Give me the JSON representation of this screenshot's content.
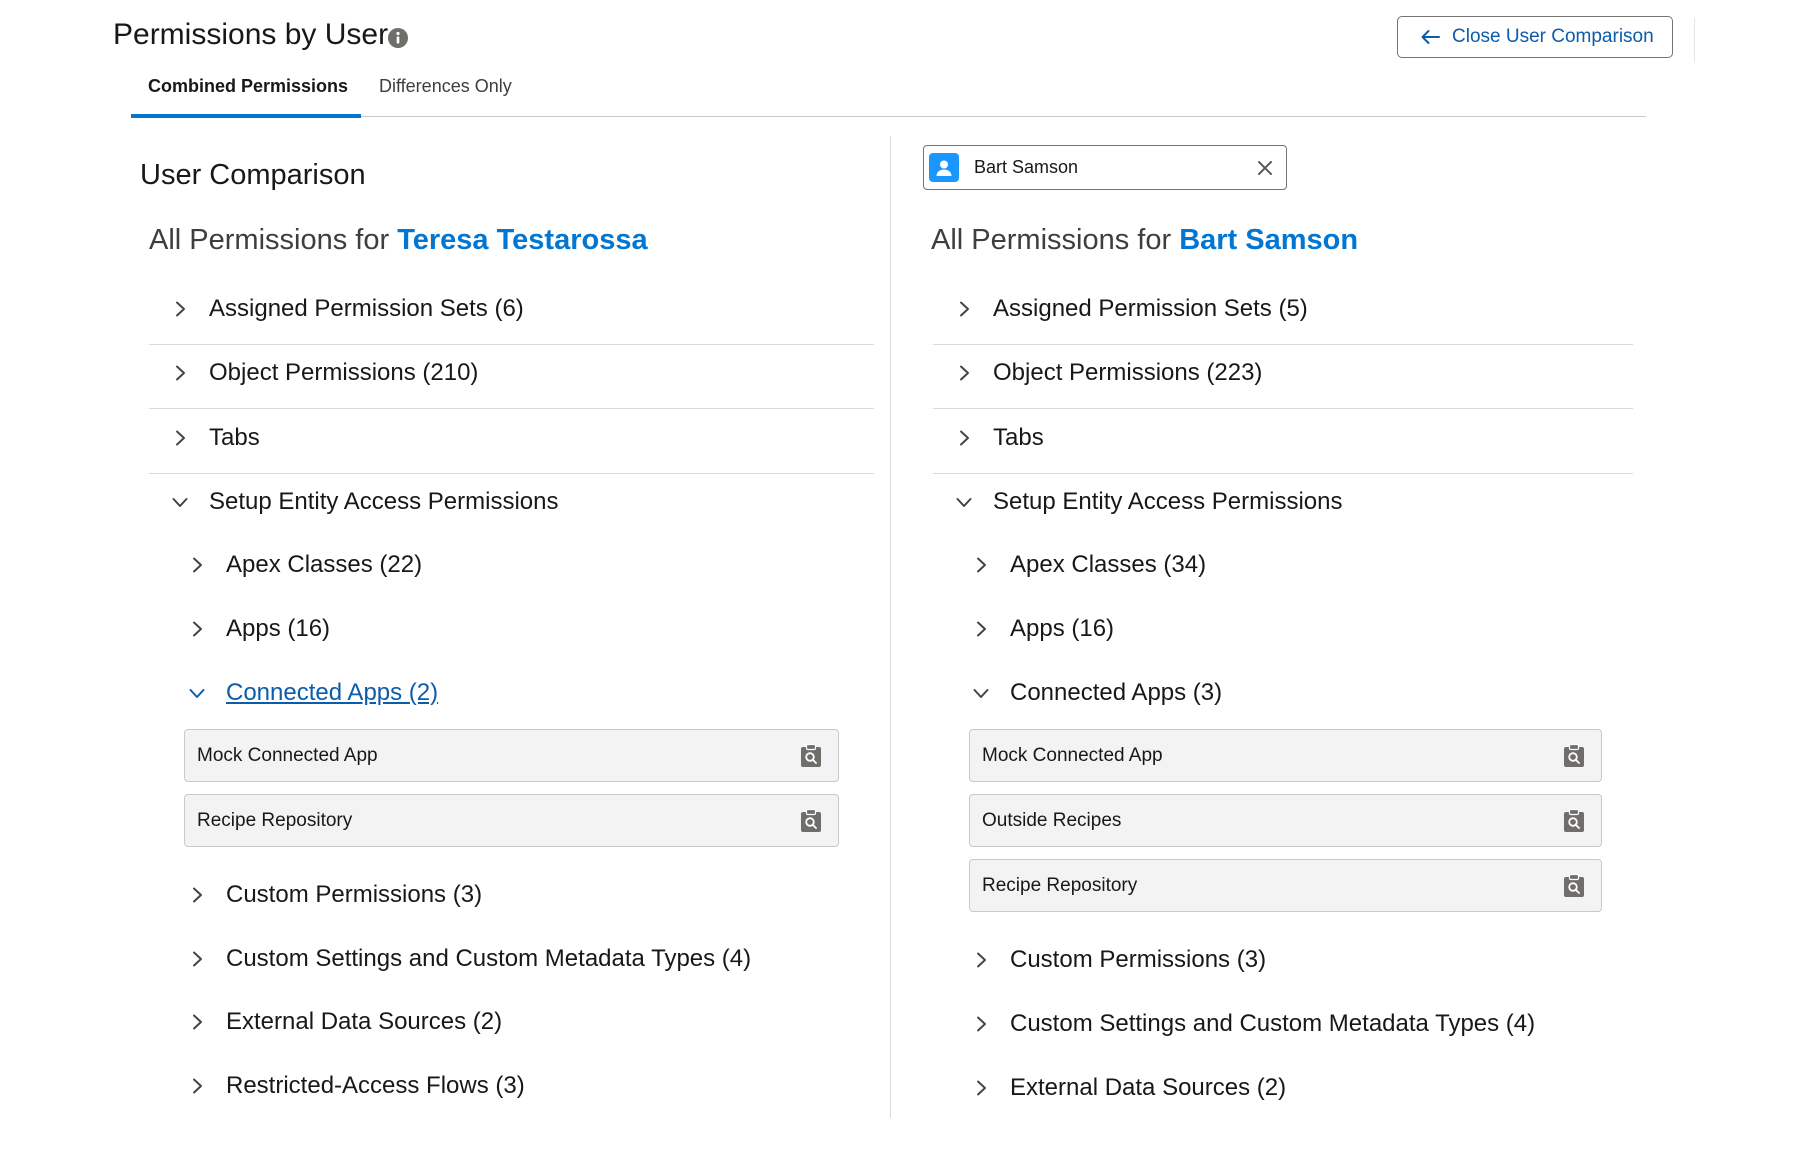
{
  "header": {
    "title": "Permissions by User",
    "info_icon": "info-icon",
    "close_button_label": "Close User Comparison",
    "close_button_icon": "arrow-left-icon"
  },
  "tabs": [
    {
      "label": "Combined Permissions",
      "active": true
    },
    {
      "label": "Differences Only",
      "active": false
    }
  ],
  "section_title": "User Comparison",
  "user_picker": {
    "selected_user": "Bart Samson",
    "avatar_icon": "user-icon",
    "clear_icon": "close-icon"
  },
  "accent_color": "#0176d3",
  "left_column": {
    "heading_prefix": "All Permissions for",
    "user_name": "Teresa Testarossa",
    "sections": [
      {
        "label": "Assigned Permission Sets (6)",
        "expanded": false
      },
      {
        "label": "Object Permissions (210)",
        "expanded": false
      },
      {
        "label": "Tabs",
        "expanded": false
      },
      {
        "label": "Setup Entity Access Permissions",
        "expanded": true,
        "children": [
          {
            "label": "Apex Classes (22)",
            "expanded": false
          },
          {
            "label": "Apps (16)",
            "expanded": false
          },
          {
            "label": "Connected Apps (2)",
            "expanded": true,
            "items": [
              "Mock Connected App",
              "Recipe Repository"
            ]
          },
          {
            "label": "Custom Permissions (3)",
            "expanded": false
          },
          {
            "label": "Custom Settings and Custom Metadata Types (4)",
            "expanded": false
          },
          {
            "label": "External Data Sources (2)",
            "expanded": false
          },
          {
            "label": "Restricted-Access Flows (3)",
            "expanded": false
          }
        ]
      }
    ]
  },
  "right_column": {
    "heading_prefix": "All Permissions for",
    "user_name": "Bart Samson",
    "sections": [
      {
        "label": "Assigned Permission Sets (5)",
        "expanded": false
      },
      {
        "label": "Object Permissions (223)",
        "expanded": false
      },
      {
        "label": "Tabs",
        "expanded": false
      },
      {
        "label": "Setup Entity Access Permissions",
        "expanded": true,
        "children": [
          {
            "label": "Apex Classes (34)",
            "expanded": false
          },
          {
            "label": "Apps (16)",
            "expanded": false
          },
          {
            "label": "Connected Apps (3)",
            "expanded": true,
            "items": [
              "Mock Connected App",
              "Outside Recipes",
              "Recipe Repository"
            ]
          },
          {
            "label": "Custom Permissions (3)",
            "expanded": false
          },
          {
            "label": "Custom Settings and Custom Metadata Types (4)",
            "expanded": false
          },
          {
            "label": "External Data Sources (2)",
            "expanded": false
          }
        ]
      }
    ]
  }
}
